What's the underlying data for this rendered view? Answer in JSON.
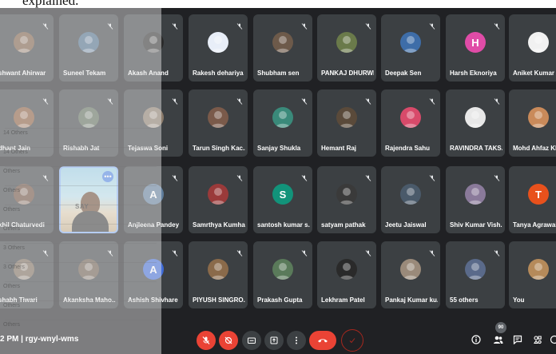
{
  "page_top_text": "explained.",
  "tiles": [
    {
      "name": "shwant Ahirwar",
      "avatar_color": "#7a5c44",
      "avatar_letter": "",
      "col": 0,
      "row": 0
    },
    {
      "name": "Suneel Tekam",
      "avatar_color": "#4a6b8a",
      "avatar_letter": "",
      "col": 1,
      "row": 0
    },
    {
      "name": "Akash Anand",
      "avatar_color": "#2b2b2b",
      "avatar_letter": "",
      "col": 2,
      "row": 0
    },
    {
      "name": "Rakesh dehariya",
      "avatar_color": "#e8eef8",
      "avatar_letter": "",
      "col": 3,
      "row": 0
    },
    {
      "name": "Shubham sen",
      "avatar_color": "#6d5a4a",
      "avatar_letter": "",
      "col": 4,
      "row": 0
    },
    {
      "name": "PANKAJ DHURWE",
      "avatar_color": "#6a7a4a",
      "avatar_letter": "",
      "col": 5,
      "row": 0
    },
    {
      "name": "Deepak Sen",
      "avatar_color": "#3e6da8",
      "avatar_letter": "",
      "col": 6,
      "row": 0
    },
    {
      "name": "Harsh Eknoriya",
      "avatar_color": "#e04ca7",
      "avatar_letter": "H",
      "col": 7,
      "row": 0
    },
    {
      "name": "Aniket Kumar",
      "avatar_color": "#f1f1f1",
      "avatar_letter": "",
      "col": 8,
      "row": 0
    },
    {
      "name": "dhant Jain",
      "avatar_color": "#8a5a3a",
      "avatar_letter": "",
      "col": 0,
      "row": 1
    },
    {
      "name": "Rishabh Jat",
      "avatar_color": "#5d6b5a",
      "avatar_letter": "",
      "col": 1,
      "row": 1
    },
    {
      "name": "Tejaswa Soni",
      "avatar_color": "#8a7a6a",
      "avatar_letter": "",
      "col": 2,
      "row": 1
    },
    {
      "name": "Tarun Singh Kac...",
      "avatar_color": "#7a5a4a",
      "avatar_letter": "",
      "col": 3,
      "row": 1
    },
    {
      "name": "Sanjay Shukla",
      "avatar_color": "#3a8a7a",
      "avatar_letter": "",
      "col": 4,
      "row": 1
    },
    {
      "name": "Hemant Raj",
      "avatar_color": "#5a4a3a",
      "avatar_letter": "",
      "col": 5,
      "row": 1
    },
    {
      "name": "Rajendra Sahu",
      "avatar_color": "#d84a6a",
      "avatar_letter": "",
      "col": 6,
      "row": 1
    },
    {
      "name": "RAVINDRA TAKS...",
      "avatar_color": "#e8e8e8",
      "avatar_letter": "",
      "col": 7,
      "row": 1
    },
    {
      "name": "Mohd Ahfaz Kh",
      "avatar_color": "#c98a5a",
      "avatar_letter": "",
      "col": 8,
      "row": 1
    },
    {
      "name": "khil Chaturvedi",
      "avatar_color": "#6a4a3a",
      "avatar_letter": "",
      "col": 0,
      "row": 2
    },
    {
      "name": "Anjleena Pandey",
      "avatar_color": "#5f7d9c",
      "avatar_letter": "A",
      "col": 2,
      "row": 2
    },
    {
      "name": "Samrthya Kumhar",
      "avatar_color": "#9a3a3a",
      "avatar_letter": "",
      "col": 3,
      "row": 2
    },
    {
      "name": "santosh kumar s...",
      "avatar_color": "#12937a",
      "avatar_letter": "S",
      "col": 4,
      "row": 2
    },
    {
      "name": "satyam pathak",
      "avatar_color": "#3a3a3a",
      "avatar_letter": "",
      "col": 5,
      "row": 2
    },
    {
      "name": "Jeetu Jaiswal",
      "avatar_color": "#4a5a6a",
      "avatar_letter": "",
      "col": 6,
      "row": 2
    },
    {
      "name": "Shiv Kumar Vish...",
      "avatar_color": "#8a7a9a",
      "avatar_letter": "",
      "col": 7,
      "row": 2
    },
    {
      "name": "Tanya Agrawal",
      "avatar_color": "#e8511c",
      "avatar_letter": "T",
      "col": 8,
      "row": 2
    },
    {
      "name": "shabh Tiwari",
      "avatar_color": "#7a6a5a",
      "avatar_letter": "",
      "col": 0,
      "row": 3
    },
    {
      "name": "Akanksha Maho...",
      "avatar_color": "#6a5a4a",
      "avatar_letter": "",
      "col": 1,
      "row": 3
    },
    {
      "name": "Ashish Shivhare",
      "avatar_color": "#3f6bd8",
      "avatar_letter": "A",
      "col": 2,
      "row": 3
    },
    {
      "name": "PIYUSH SINGRO...",
      "avatar_color": "#8a6a4a",
      "avatar_letter": "",
      "col": 3,
      "row": 3
    },
    {
      "name": "Prakash Gupta",
      "avatar_color": "#5a7a5a",
      "avatar_letter": "",
      "col": 4,
      "row": 3
    },
    {
      "name": "Lekhram Patel",
      "avatar_color": "#2a2a2a",
      "avatar_letter": "",
      "col": 5,
      "row": 3
    },
    {
      "name": "Pankaj Kumar ku...",
      "avatar_color": "#9a8a7a",
      "avatar_letter": "",
      "col": 6,
      "row": 3
    },
    {
      "name": "55 others",
      "avatar_color": "#5a6a8a",
      "avatar_letter": "",
      "col": 7,
      "row": 3
    },
    {
      "name": "You",
      "avatar_color": "#b58a5a",
      "avatar_letter": "",
      "col": 8,
      "row": 3
    }
  ],
  "video_tile": {
    "label": "SAY",
    "more": "•••"
  },
  "overlay_rows": [
    "14 Others",
    "14 Others",
    "Others",
    "Others",
    "Others",
    "Others",
    "3 Others",
    "3 Others",
    "Others",
    "Others",
    "Others"
  ],
  "bottom_bar": {
    "meeting_code": "2 PM  |  rgy-wnyl-wms",
    "people_badge": "90"
  }
}
